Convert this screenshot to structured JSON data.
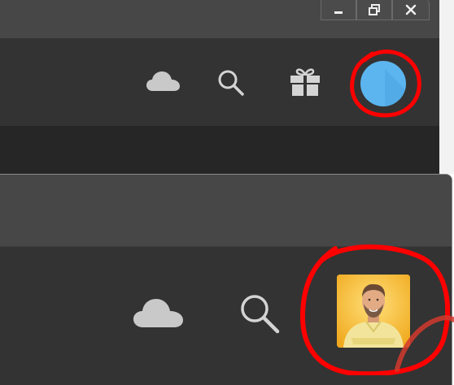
{
  "top_window": {
    "controls": [
      "minimize-icon",
      "restore-icon",
      "close-icon"
    ],
    "toolbar_icons": [
      "cloud-icon",
      "search-icon",
      "gift-icon"
    ],
    "avatar": {
      "color": "#5cb5ef"
    }
  },
  "bottom_window": {
    "toolbar_icons": [
      "cloud-icon",
      "search-icon"
    ],
    "avatar": {
      "type": "photo",
      "background": "#f3b92a"
    }
  },
  "annotation_color": "#ff0000"
}
